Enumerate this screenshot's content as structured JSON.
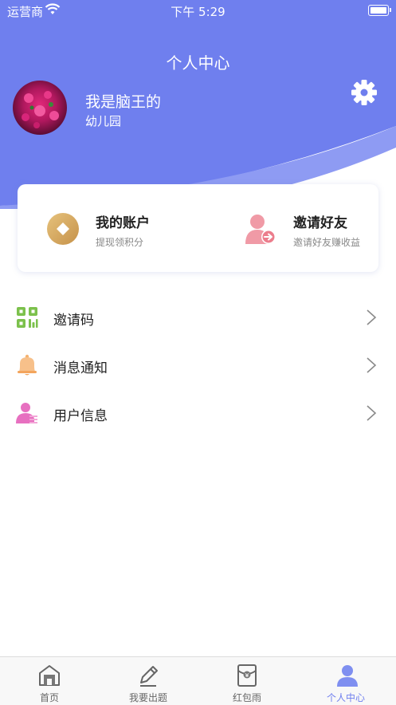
{
  "status_bar": {
    "carrier": "运营商",
    "time": "下午 5:29"
  },
  "header": {
    "title": "个人中心"
  },
  "user": {
    "name": "我是脑王的",
    "subtitle": "幼儿园"
  },
  "card": {
    "account": {
      "title": "我的账户",
      "subtitle": "提现领积分"
    },
    "invite": {
      "title": "邀请好友",
      "subtitle": "邀请好友赚收益"
    }
  },
  "menu": [
    {
      "label": "邀请码",
      "icon": "qr-code-icon"
    },
    {
      "label": "消息通知",
      "icon": "bell-icon"
    },
    {
      "label": "用户信息",
      "icon": "user-info-icon"
    }
  ],
  "tabbar": [
    {
      "label": "首页",
      "icon": "home-icon",
      "active": false
    },
    {
      "label": "我要出题",
      "icon": "pencil-icon",
      "active": false
    },
    {
      "label": "红包雨",
      "icon": "red-envelope-icon",
      "active": false
    },
    {
      "label": "个人中心",
      "icon": "person-icon",
      "active": true
    }
  ],
  "colors": {
    "header": "#6f7fee",
    "header_light": "#8e9bf3",
    "accent": "#6f7fee",
    "gold": "#d4a85a",
    "pink": "#ee8a99"
  }
}
